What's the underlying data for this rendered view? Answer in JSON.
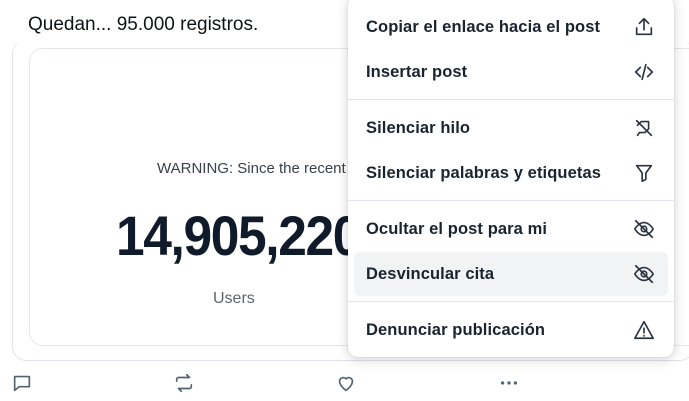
{
  "post": {
    "text": "Quedan... 95.000 registros."
  },
  "embed": {
    "warning": "WARNING: Since the recent",
    "counter": "14,905,220",
    "counter_label": "Users"
  },
  "menu": {
    "items": [
      {
        "label": "Copiar el enlace hacia el post",
        "icon": "share-icon"
      },
      {
        "label": "Insertar post",
        "icon": "code-icon"
      },
      {
        "label": "Silenciar hilo",
        "icon": "mute-thread-icon"
      },
      {
        "label": "Silenciar palabras y etiquetas",
        "icon": "filter-icon"
      },
      {
        "label": "Ocultar el post para mi",
        "icon": "eye-slash-icon"
      },
      {
        "label": "Desvincular cita",
        "icon": "eye-slash-icon"
      },
      {
        "label": "Denunciar publicación",
        "icon": "warning-icon"
      }
    ]
  },
  "actions": {
    "icons": [
      "reply-icon",
      "repost-icon",
      "like-icon",
      "more-icon"
    ]
  },
  "colors": {
    "text": "#0f1419",
    "muted": "#536471",
    "hover_bg": "#f1f3f5"
  }
}
